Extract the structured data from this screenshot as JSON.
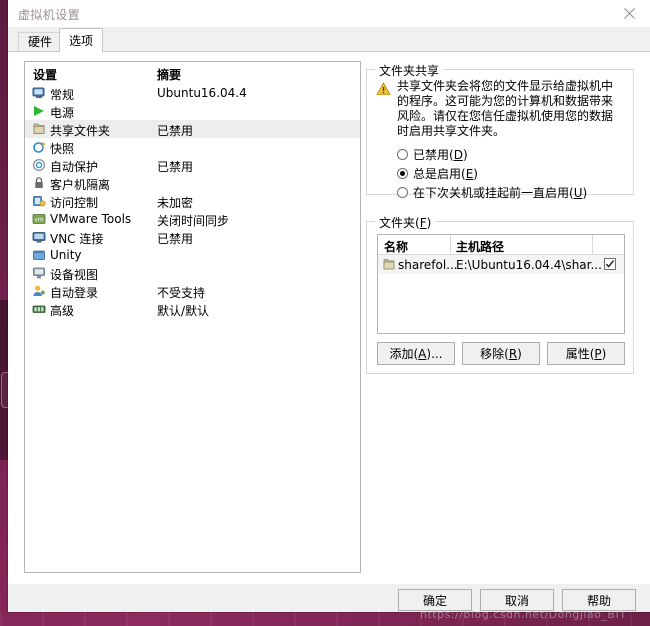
{
  "window": {
    "title": "虚拟机设置",
    "close_icon": "close-icon"
  },
  "tabs": [
    {
      "label": "硬件",
      "selected": false
    },
    {
      "label": "选项",
      "selected": true
    }
  ],
  "settings_list": {
    "headers": {
      "setting": "设置",
      "summary": "摘要"
    },
    "rows": [
      {
        "icon": "monitor-icon",
        "name": "常规",
        "summary": "Ubuntu16.04.4",
        "selected": false
      },
      {
        "icon": "play-icon",
        "name": "电源",
        "summary": "",
        "selected": false
      },
      {
        "icon": "folder-icon",
        "name": "共享文件夹",
        "summary": "已禁用",
        "selected": true
      },
      {
        "icon": "camera-icon",
        "name": "快照",
        "summary": "",
        "selected": false
      },
      {
        "icon": "shield-circle-icon",
        "name": "自动保护",
        "summary": "已禁用",
        "selected": false
      },
      {
        "icon": "lock-icon",
        "name": "客户机隔离",
        "summary": "",
        "selected": false
      },
      {
        "icon": "key-icon",
        "name": "访问控制",
        "summary": "未加密",
        "selected": false
      },
      {
        "icon": "vmware-tools-icon",
        "name": "VMware Tools",
        "summary": "关闭时间同步",
        "selected": false
      },
      {
        "icon": "display-icon",
        "name": "VNC 连接",
        "summary": "已禁用",
        "selected": false
      },
      {
        "icon": "window-icon",
        "name": "Unity",
        "summary": "",
        "selected": false
      },
      {
        "icon": "device-view-icon",
        "name": "设备视图",
        "summary": "",
        "selected": false
      },
      {
        "icon": "user-icon",
        "name": "自动登录",
        "summary": "不受支持",
        "selected": false
      },
      {
        "icon": "advanced-icon",
        "name": "高级",
        "summary": "默认/默认",
        "selected": false
      }
    ]
  },
  "folder_sharing": {
    "group_title": "文件夹共享",
    "warning_icon": "warning-triangle-icon",
    "warning_text": "共享文件夹会将您的文件显示给虚拟机中的程序。这可能为您的计算机和数据带来风险。请仅在您信任虚拟机使用您的数据时启用共享文件夹。",
    "options": [
      {
        "label_pre": "已禁用(",
        "accel": "D",
        "label_post": ")",
        "selected": false
      },
      {
        "label_pre": "总是启用(",
        "accel": "E",
        "label_post": ")",
        "selected": true
      },
      {
        "label_pre": "在下次关机或挂起前一直启用(",
        "accel": "U",
        "label_post": ")",
        "selected": false
      }
    ]
  },
  "folders": {
    "group_title_pre": "文件夹(",
    "group_title_accel": "F",
    "group_title_post": ")",
    "columns": [
      "名称",
      "主机路径",
      ""
    ],
    "rows": [
      {
        "icon": "folder-icon",
        "name": "sharefol...",
        "host_path": "E:\\Ubuntu16.04.4\\shar...",
        "enabled": true
      }
    ],
    "buttons": [
      {
        "label_pre": "添加(",
        "accel": "A",
        "label_post": ")..."
      },
      {
        "label_pre": "移除(",
        "accel": "R",
        "label_post": ")"
      },
      {
        "label_pre": "属性(",
        "accel": "P",
        "label_post": ")"
      }
    ]
  },
  "footer": {
    "ok": "确定",
    "cancel": "取消",
    "help": "帮助"
  },
  "watermark": {
    "text": "https://blog.csdn.net/Dongjiao_BIT"
  },
  "colors": {
    "accent_purple": "#7a2352",
    "dialog_bg": "#f0f0f0",
    "selection": "#ededed",
    "warning": "#f2c230"
  }
}
